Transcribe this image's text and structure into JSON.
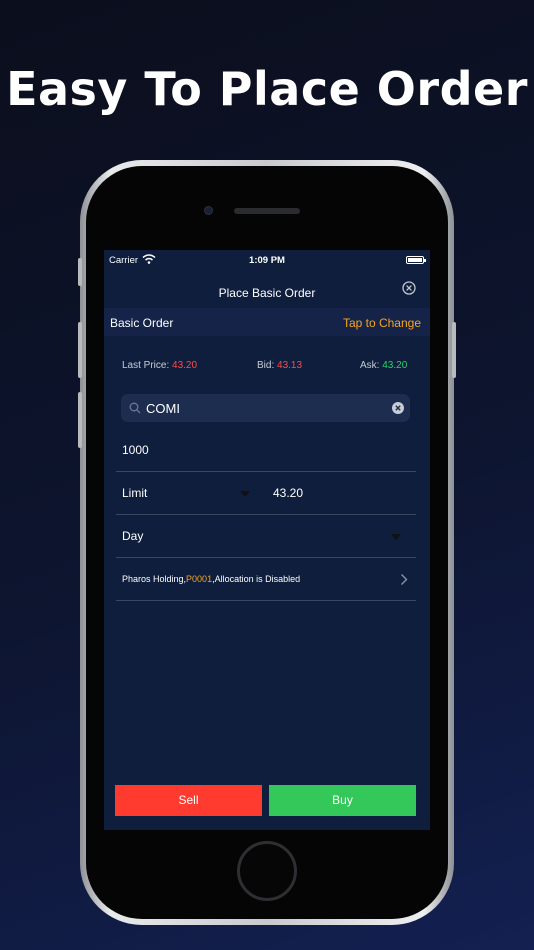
{
  "headline": "Easy To Place Order",
  "status_bar": {
    "carrier": "Carrier",
    "time": "1:09 PM"
  },
  "nav": {
    "title": "Place Basic Order",
    "close_icon": "close-circle-icon"
  },
  "order_type": {
    "label": "Basic Order",
    "change_link": "Tap to Change"
  },
  "quote": {
    "last_price_label": "Last Price:",
    "last_price": "43.20",
    "bid_label": "Bid:",
    "bid": "43.13",
    "ask_label": "Ask:",
    "ask": "43.20"
  },
  "search": {
    "value": "COMI",
    "icon": "search-icon",
    "clear_icon": "clear-icon"
  },
  "quantity": {
    "value": "1000"
  },
  "order_kind": {
    "value": "Limit",
    "price": "43.20"
  },
  "validity": {
    "value": "Day"
  },
  "allocation": {
    "prefix": "Pharos Holding,",
    "code": "P0001",
    "suffix": ",Allocation is Disabled"
  },
  "actions": {
    "sell": "Sell",
    "buy": "Buy"
  },
  "colors": {
    "sell": "#ff3b30",
    "buy": "#34c759",
    "accent": "#f5a623",
    "down": "#ff4a4a",
    "up": "#2fd16a",
    "screen_bg": "#0f1e3d"
  }
}
